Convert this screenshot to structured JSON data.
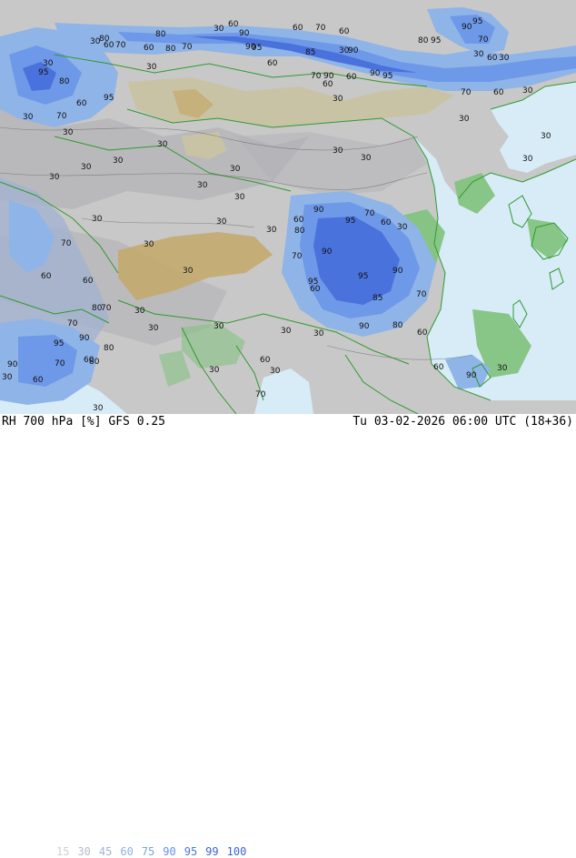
{
  "footer": {
    "title": "RH 700 hPa [%] GFS 0.25",
    "datetime": "Tu 03-02-2026 06:00 UTC (18+36)"
  },
  "legend": {
    "levels": [
      {
        "label": "15",
        "color": "#ccd0d8"
      },
      {
        "label": "30",
        "color": "#b4bccb"
      },
      {
        "label": "45",
        "color": "#a3b3cf"
      },
      {
        "label": "60",
        "color": "#8fb0e0"
      },
      {
        "label": "75",
        "color": "#7aa1e8"
      },
      {
        "label": "90",
        "color": "#6490ea"
      },
      {
        "label": "95",
        "color": "#4a78e0"
      },
      {
        "label": "99",
        "color": "#3a64d6"
      },
      {
        "label": "100",
        "color": "#3a64d6"
      }
    ]
  },
  "map_colors": {
    "sea": "#d7ecf7",
    "gray": "#c8c8c8",
    "dark_gray": "#b2b2b6",
    "dry_land": "#c9c3a6",
    "tan": "#c4a86a",
    "green": "#7fc27a",
    "coast": "#2f9a2f",
    "blue_light": "#8fb4e8",
    "blue_mid": "#6e98e8",
    "blue_dark": "#4a72dc"
  },
  "contour_labels": [
    {
      "v": "30"
    },
    {
      "v": "60"
    },
    {
      "v": "90"
    },
    {
      "v": "60"
    },
    {
      "v": "70"
    },
    {
      "v": "60"
    },
    {
      "v": "90"
    },
    {
      "v": "95"
    },
    {
      "v": "30"
    },
    {
      "v": "60"
    },
    {
      "v": "70"
    },
    {
      "v": "60"
    },
    {
      "v": "80"
    },
    {
      "v": "80"
    },
    {
      "v": "70"
    },
    {
      "v": "90"
    },
    {
      "v": "95"
    },
    {
      "v": "60"
    },
    {
      "v": "85"
    },
    {
      "v": "30"
    },
    {
      "v": "30"
    },
    {
      "v": "70"
    },
    {
      "v": "60"
    },
    {
      "v": "90"
    },
    {
      "v": "60"
    },
    {
      "v": "90"
    },
    {
      "v": "80"
    },
    {
      "v": "95"
    },
    {
      "v": "70"
    },
    {
      "v": "60"
    },
    {
      "v": "30"
    },
    {
      "v": "30"
    },
    {
      "v": "60"
    },
    {
      "v": "70"
    },
    {
      "v": "95"
    },
    {
      "v": "90"
    },
    {
      "v": "30"
    },
    {
      "v": "95"
    },
    {
      "v": "80"
    },
    {
      "v": "30"
    },
    {
      "v": "80"
    },
    {
      "v": "60"
    },
    {
      "v": "95"
    },
    {
      "v": "70"
    },
    {
      "v": "30"
    },
    {
      "v": "30"
    },
    {
      "v": "30"
    },
    {
      "v": "30"
    },
    {
      "v": "30"
    },
    {
      "v": "30"
    },
    {
      "v": "30"
    },
    {
      "v": "30"
    },
    {
      "v": "30"
    },
    {
      "v": "30"
    },
    {
      "v": "30"
    },
    {
      "v": "30"
    },
    {
      "v": "30"
    },
    {
      "v": "30"
    },
    {
      "v": "30"
    },
    {
      "v": "30"
    },
    {
      "v": "30"
    },
    {
      "v": "90"
    },
    {
      "v": "95"
    },
    {
      "v": "70"
    },
    {
      "v": "60"
    },
    {
      "v": "30"
    },
    {
      "v": "60"
    },
    {
      "v": "80"
    },
    {
      "v": "70"
    },
    {
      "v": "90"
    },
    {
      "v": "95"
    },
    {
      "v": "60"
    },
    {
      "v": "95"
    },
    {
      "v": "90"
    },
    {
      "v": "85"
    },
    {
      "v": "70"
    },
    {
      "v": "90"
    },
    {
      "v": "80"
    },
    {
      "v": "60"
    },
    {
      "v": "30"
    },
    {
      "v": "70"
    },
    {
      "v": "60"
    },
    {
      "v": "60"
    },
    {
      "v": "80"
    },
    {
      "v": "70"
    },
    {
      "v": "30"
    },
    {
      "v": "30"
    },
    {
      "v": "70"
    },
    {
      "v": "95"
    },
    {
      "v": "90"
    },
    {
      "v": "80"
    },
    {
      "v": "60"
    },
    {
      "v": "90"
    },
    {
      "v": "70"
    },
    {
      "v": "80"
    },
    {
      "v": "60"
    },
    {
      "v": "30"
    },
    {
      "v": "30"
    },
    {
      "v": "30"
    },
    {
      "v": "60"
    },
    {
      "v": "30"
    },
    {
      "v": "70"
    },
    {
      "v": "30"
    },
    {
      "v": "30"
    },
    {
      "v": "30"
    },
    {
      "v": "60"
    },
    {
      "v": "90"
    },
    {
      "v": "30"
    },
    {
      "v": "30"
    },
    {
      "v": "30"
    }
  ]
}
